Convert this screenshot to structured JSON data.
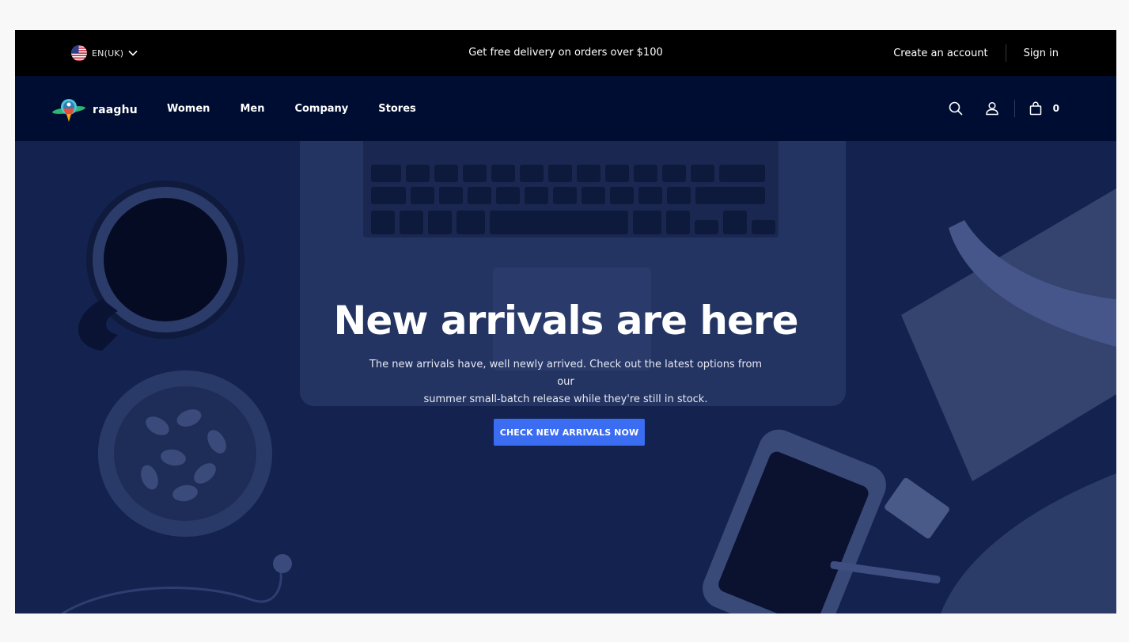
{
  "topbar": {
    "language": "EN(UK)",
    "promo": "Get free delivery on orders over $100",
    "create_account": "Create an account",
    "sign_in": "Sign in"
  },
  "navbar": {
    "brand": "raaghu",
    "menu": [
      "Women",
      "Men",
      "Company",
      "Stores"
    ],
    "cart_count": "0"
  },
  "hero": {
    "title": "New arrivals are here",
    "text_line1": "The new arrivals have, well newly arrived. Check out the latest options from our",
    "text_line2": "summer small-batch release while they're still in stock.",
    "cta": "CHECK NEW ARRIVALS NOW"
  },
  "colors": {
    "topbar_bg": "#000000",
    "navbar_bg": "#000d33",
    "hero_overlay": "#14224f",
    "cta_bg": "#3b6df2"
  }
}
